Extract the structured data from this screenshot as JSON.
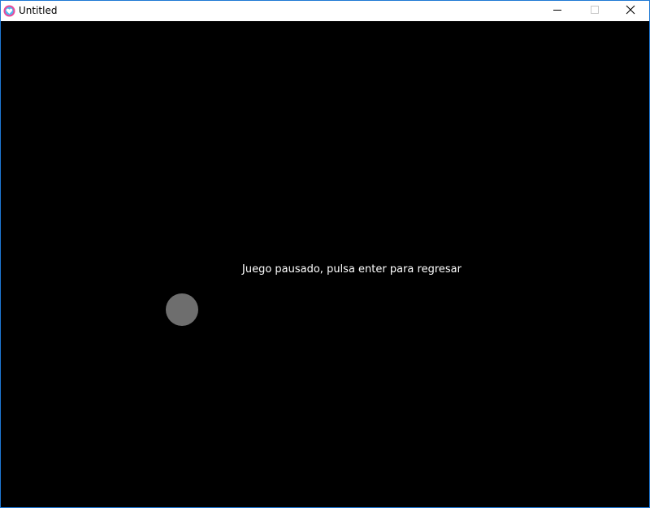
{
  "window": {
    "title": "Untitled",
    "app_icon": "heart-app-icon",
    "controls": {
      "minimize_icon": "minimize-icon",
      "maximize_icon": "maximize-icon",
      "close_icon": "close-icon"
    }
  },
  "game": {
    "pause_message": "Juego pausado, pulsa enter para regresar",
    "background_color": "#000000",
    "text_color": "#ffffff",
    "ball_color": "#6e6e6e"
  }
}
